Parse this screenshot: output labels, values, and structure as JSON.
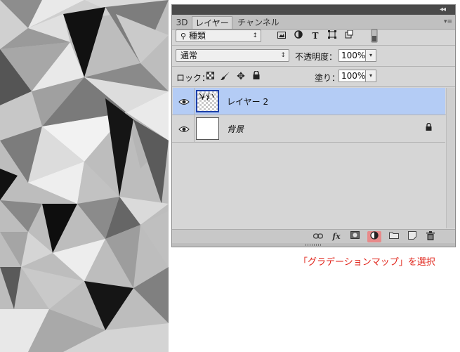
{
  "panel": {
    "tabs": [
      "3D",
      "レイヤー",
      "チャンネル"
    ],
    "active_tab": "レイヤー",
    "collapse_glyph": "◂◂",
    "menu_glyph": "▾≡"
  },
  "filter": {
    "kind_label": "種類",
    "icons": [
      "image-filter-icon",
      "adjustment-filter-icon",
      "type-filter-icon",
      "shape-filter-icon",
      "smart-object-filter-icon"
    ],
    "type_icon_glyph": "T"
  },
  "blend": {
    "mode": "通常",
    "opacity_label": "不透明度：",
    "opacity_value": "100%"
  },
  "lock": {
    "label": "ロック：",
    "fill_label": "塗り：",
    "fill_value": "100%"
  },
  "layers": [
    {
      "name": "レイヤー 2",
      "selected": true,
      "visible": true,
      "locked": false
    },
    {
      "name": "背景",
      "selected": false,
      "visible": true,
      "locked": true
    }
  ],
  "bottom_toolbar": {
    "fx_label": "fx",
    "items": [
      "link-layers",
      "add-layer-style",
      "add-mask",
      "new-fill-adjustment-layer",
      "new-group",
      "new-layer",
      "delete-layer"
    ],
    "highlighted": "new-fill-adjustment-layer"
  },
  "caption": "「グラデーションマップ」を選択",
  "colors": {
    "selected_row": "#b4ccf5",
    "highlight_button": "#e88a8a",
    "caption": "#e1261c",
    "panel_bg": "#d6d6d6"
  }
}
